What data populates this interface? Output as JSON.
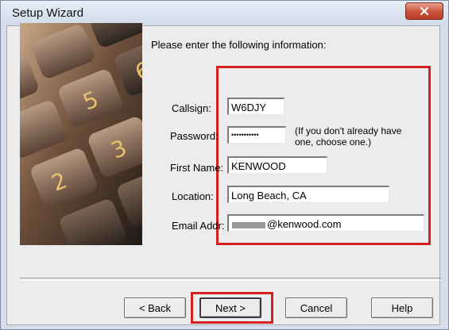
{
  "window": {
    "title": "Setup Wizard"
  },
  "form": {
    "prompt": "Please enter the following information:",
    "hint": "(If you don't already have one, choose one.)",
    "fields": {
      "callsign": {
        "label": "Callsign:",
        "value": "W6DJY"
      },
      "password": {
        "label": "Password:",
        "value": "•••••••••••"
      },
      "first_name": {
        "label": "First Name:",
        "value": "KENWOOD"
      },
      "location": {
        "label": "Location:",
        "value": "Long Beach, CA"
      },
      "email": {
        "label": "Email Addr:",
        "value_suffix": "@kenwood.com"
      }
    }
  },
  "buttons": {
    "back": "< Back",
    "next": "Next >",
    "cancel": "Cancel",
    "help": "Help"
  },
  "colors": {
    "highlight": "#d42020"
  }
}
